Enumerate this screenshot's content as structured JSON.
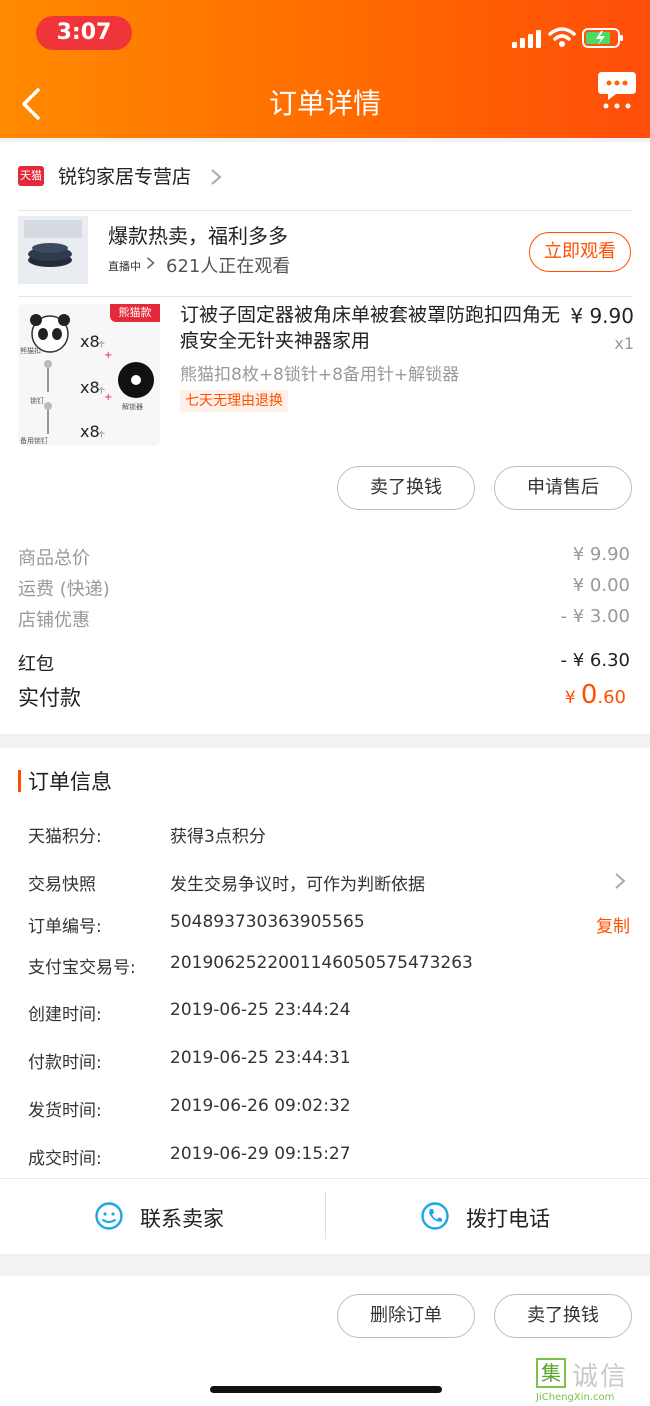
{
  "status_bar": {
    "time": "3:07"
  },
  "header": {
    "title": "订单详情"
  },
  "store": {
    "badge": "天猫",
    "name": "锐钧家居专营店"
  },
  "live": {
    "title": "爆款热卖，福利多多",
    "tag": "直播中",
    "viewers": "621人正在观看",
    "watch_label": "立即观看"
  },
  "product": {
    "tag": "熊猫款",
    "title": "订被子固定器被角床单被套被罩防跑扣四角无痕安全无针夹神器家用",
    "price": "¥ 9.90",
    "qty": "x1",
    "sku": "熊猫扣8枚+8锁针+8备用针+解锁器",
    "return_policy": "七天无理由退换",
    "image_labels": {
      "panda": "熊猫扣",
      "lock_pin": "锁钉",
      "spare_pin": "备用锁钉",
      "unlocker": "解锁器",
      "x8": "x8",
      "unit": "个"
    }
  },
  "product_actions": {
    "sell_label": "卖了换钱",
    "after_sale_label": "申请售后"
  },
  "fees": {
    "items": [
      {
        "label": "商品总价",
        "value": "¥ 9.90"
      },
      {
        "label": "运费 (快递)",
        "value": "¥ 0.00"
      },
      {
        "label": "店铺优惠",
        "value": "- ¥ 3.00"
      },
      {
        "label": "红包",
        "value": "- ¥ 6.30"
      }
    ],
    "paid_label": "实付款",
    "paid_symbol": "¥",
    "paid_int": "0",
    "paid_dec": ".60"
  },
  "order_info": {
    "title": "订单信息",
    "rows": [
      {
        "label": "天猫积分:",
        "value": "获得3点积分"
      },
      {
        "label": "交易快照",
        "value": "发生交易争议时，可作为判断依据"
      },
      {
        "label": "订单编号:",
        "value": "504893730363905565"
      },
      {
        "label": "支付宝交易号:",
        "value": "2019062522001146050575473263"
      },
      {
        "label": "创建时间:",
        "value": "2019-06-25 23:44:24"
      },
      {
        "label": "付款时间:",
        "value": "2019-06-25 23:44:31"
      },
      {
        "label": "发货时间:",
        "value": "2019-06-26 09:02:32"
      },
      {
        "label": "成交时间:",
        "value": "2019-06-29 09:15:27"
      }
    ],
    "copy_label": "复制",
    "contact_seller": "联系卖家",
    "call_phone": "拨打电话"
  },
  "bottom_actions": {
    "delete_label": "删除订单",
    "sell_label": "卖了换钱"
  },
  "watermark": {
    "mark": "集",
    "text": "诚信",
    "url": "JiChengXin.com"
  },
  "colors": {
    "accent": "#ff5000",
    "header_start": "#ff8a00",
    "header_end": "#ff4d0a",
    "tmall_red": "#e4293a"
  }
}
